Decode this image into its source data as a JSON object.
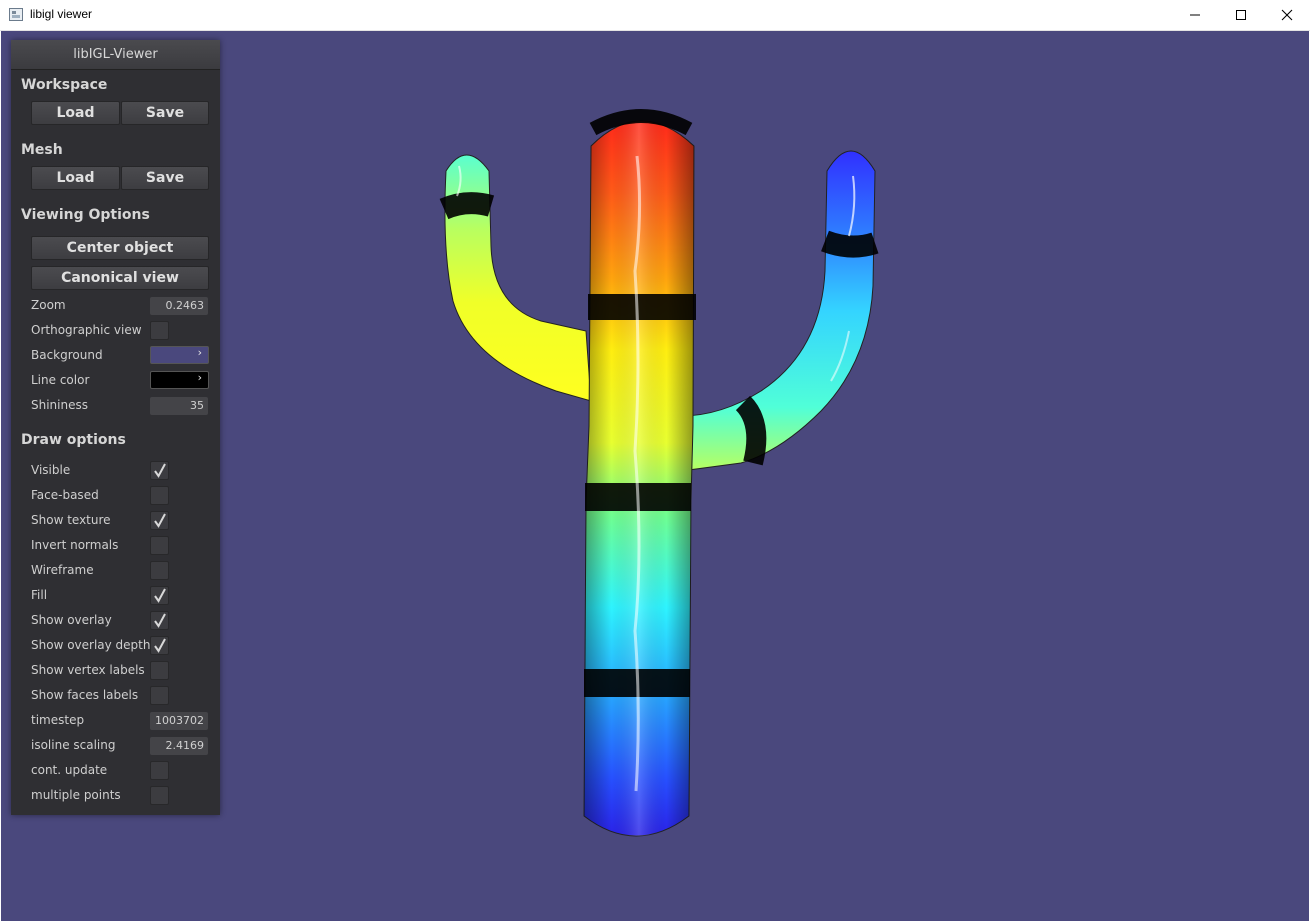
{
  "window": {
    "title": "libigl viewer"
  },
  "panel": {
    "title": "libIGL-Viewer",
    "workspace": {
      "heading": "Workspace",
      "load": "Load",
      "save": "Save"
    },
    "mesh": {
      "heading": "Mesh",
      "load": "Load",
      "save": "Save"
    },
    "viewing": {
      "heading": "Viewing Options",
      "center_object": "Center object",
      "canonical_view": "Canonical view",
      "zoom_label": "Zoom",
      "zoom_value": "0.2463",
      "ortho_label": "Orthographic view",
      "ortho_checked": false,
      "background_label": "Background",
      "background_color": "#4a487d",
      "line_color_label": "Line color",
      "line_color": "#000000",
      "shininess_label": "Shininess",
      "shininess_value": "35"
    },
    "draw": {
      "heading": "Draw options",
      "options": [
        {
          "label": "Visible",
          "checked": true
        },
        {
          "label": "Face-based",
          "checked": false
        },
        {
          "label": "Show texture",
          "checked": true
        },
        {
          "label": "Invert normals",
          "checked": false
        },
        {
          "label": "Wireframe",
          "checked": false
        },
        {
          "label": "Fill",
          "checked": true
        },
        {
          "label": "Show overlay",
          "checked": true
        },
        {
          "label": "Show overlay depth",
          "checked": true
        },
        {
          "label": "Show vertex labels",
          "checked": false
        },
        {
          "label": "Show faces labels",
          "checked": false
        }
      ],
      "timestep_label": "timestep",
      "timestep_value": "1003702",
      "isoline_label": "isoline scaling",
      "isoline_value": "2.4169",
      "cont_update_label": "cont. update",
      "cont_update_checked": false,
      "multiple_points_label": "multiple points",
      "multiple_points_checked": false
    }
  },
  "scene": {
    "background": "#4a487d",
    "mesh_icon": "cactus-mesh"
  }
}
